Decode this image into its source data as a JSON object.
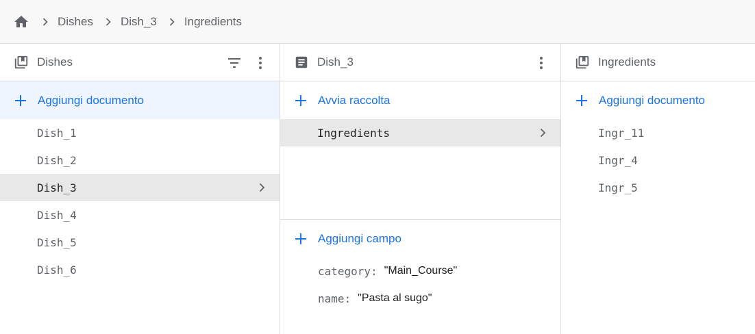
{
  "breadcrumb": {
    "items": [
      "Dishes",
      "Dish_3",
      "Ingredients"
    ]
  },
  "panel_dishes": {
    "title": "Dishes",
    "add_label": "Aggiungi documento",
    "items": [
      "Dish_1",
      "Dish_2",
      "Dish_3",
      "Dish_4",
      "Dish_5",
      "Dish_6"
    ],
    "selected": "Dish_3"
  },
  "panel_document": {
    "title": "Dish_3",
    "start_collection_label": "Avvia raccolta",
    "collections": [
      "Ingredients"
    ],
    "add_field_label": "Aggiungi campo",
    "fields": [
      {
        "key": "category:",
        "value": "\"Main_Course\""
      },
      {
        "key": "name:",
        "value": "\"Pasta al sugo\""
      }
    ]
  },
  "panel_ingredients": {
    "title": "Ingredients",
    "add_label": "Aggiungi documento",
    "items": [
      "Ingr_11",
      "Ingr_4",
      "Ingr_5"
    ]
  },
  "colors": {
    "accent": "#1a73e8",
    "selected_bg": "#e8e8e8",
    "active_add_bg": "#eef5fe"
  }
}
